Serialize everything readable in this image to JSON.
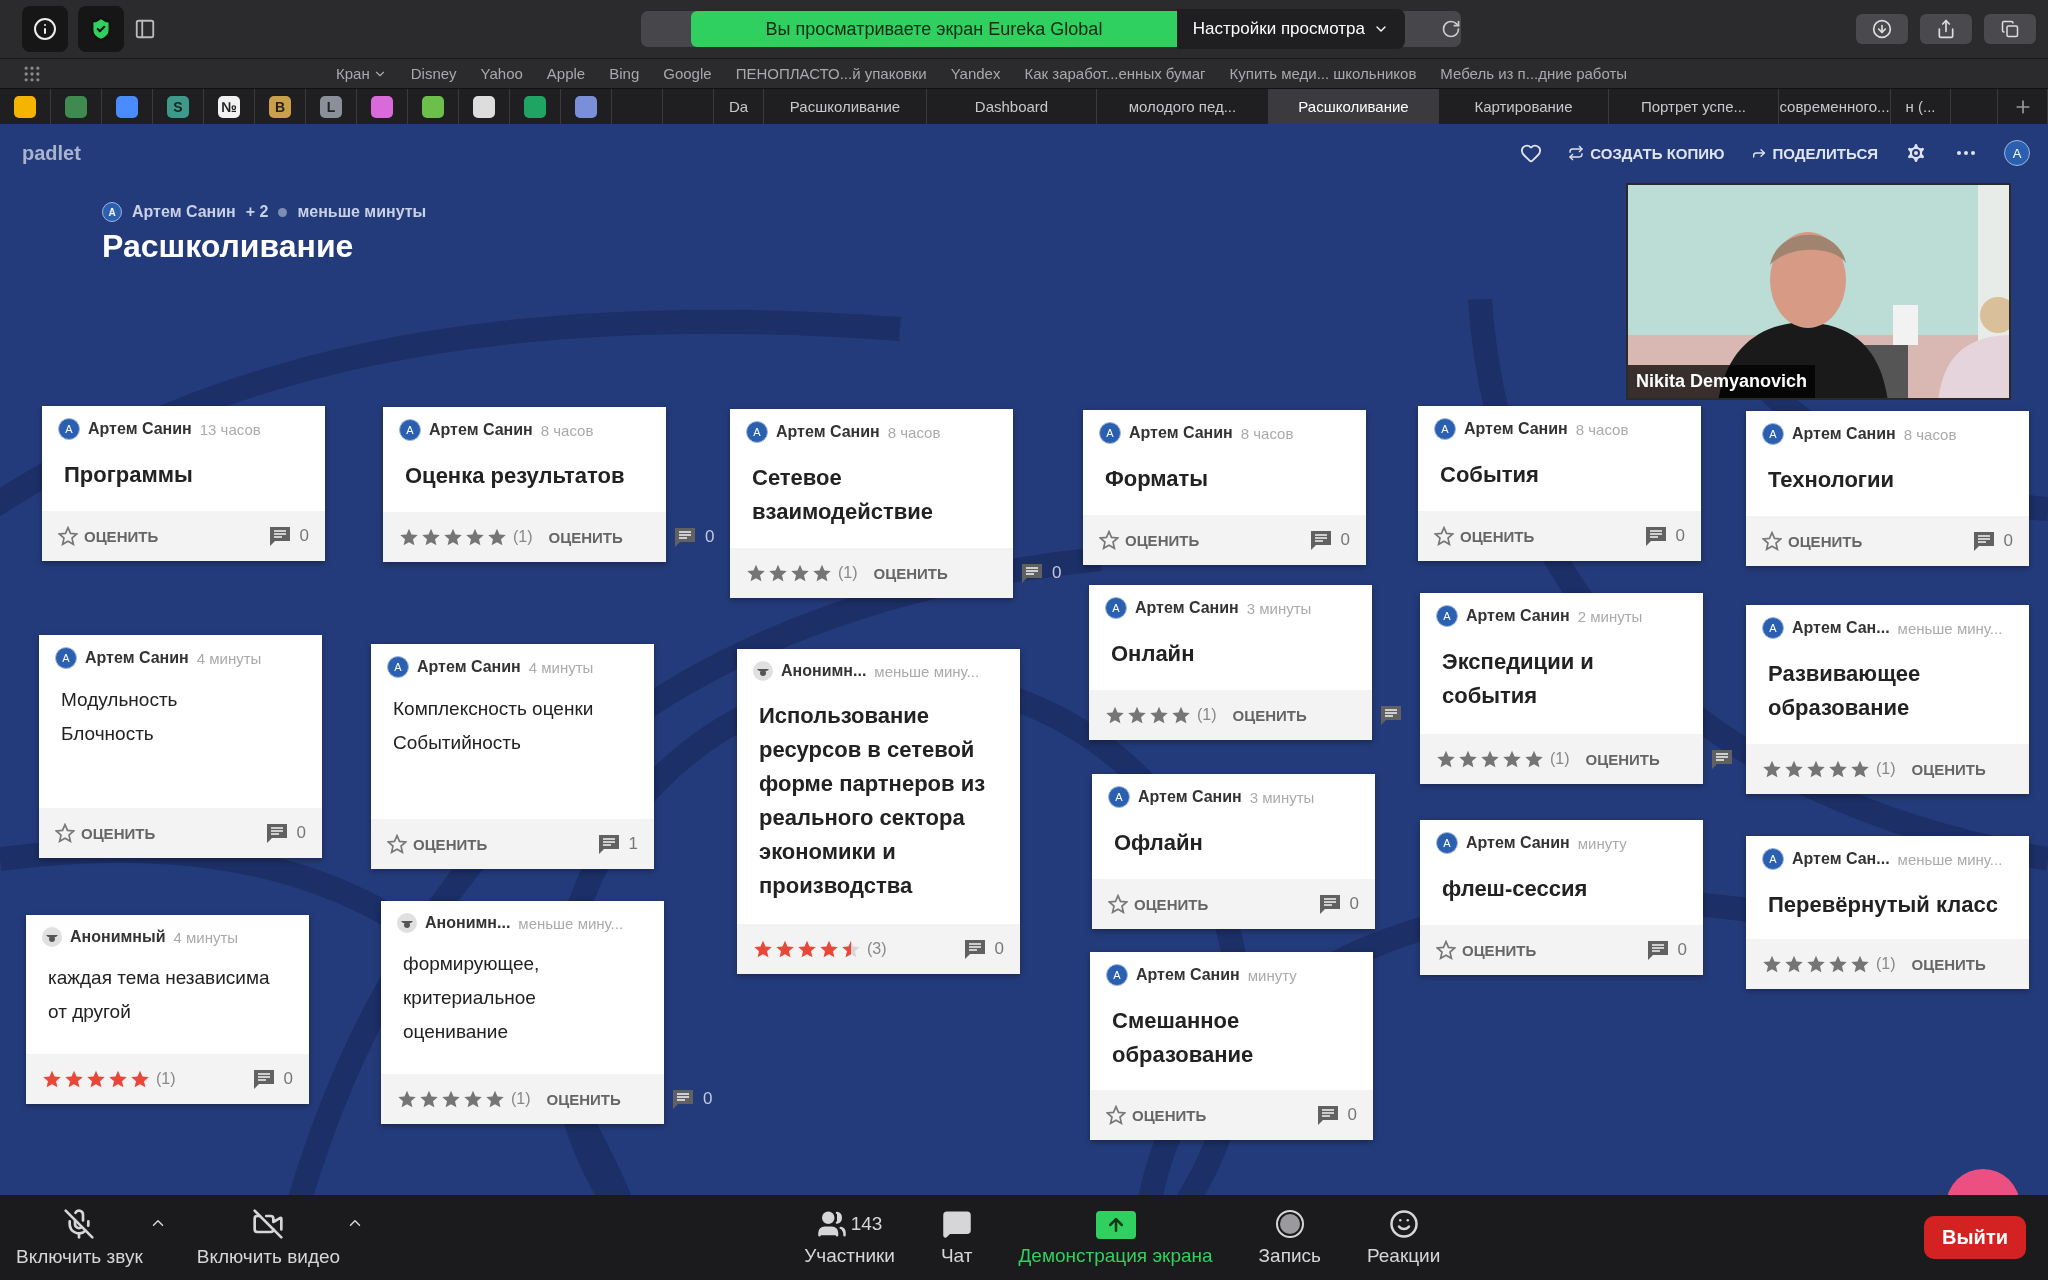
{
  "browser": {
    "viewing_banner": "Вы просматриваете экран Eureka Global",
    "view_options": "Настройки просмотра",
    "bookmarks": [
      {
        "label": "Кран",
        "folder": true
      },
      {
        "label": "Disney",
        "folder": false
      },
      {
        "label": "Yahoo",
        "folder": false
      },
      {
        "label": "Apple",
        "folder": false
      },
      {
        "label": "Bing",
        "folder": false
      },
      {
        "label": "Google",
        "folder": false
      },
      {
        "label": "ПЕНОПЛАСТО...й упаковки",
        "folder": false
      },
      {
        "label": "Yandex",
        "folder": false
      },
      {
        "label": "Как заработ...енных бумаг",
        "folder": false
      },
      {
        "label": "Купить меди... школьников",
        "folder": false
      },
      {
        "label": "Мебель из п...дние работы",
        "folder": false
      }
    ],
    "pinned_tabs": [
      {
        "color": "#f4b400"
      },
      {
        "color": "#3f8a4e"
      },
      {
        "color": "#4a8cff"
      },
      {
        "color": "#3d9a8a",
        "glyph": "S"
      },
      {
        "color": "#f2f2f2",
        "glyph": "№"
      },
      {
        "color": "#caa14a",
        "glyph": "B"
      },
      {
        "color": "#8a8f99",
        "glyph": "L"
      },
      {
        "color": "#d96ad9"
      },
      {
        "color": "#6cbf4a"
      },
      {
        "color": "#dddddd"
      },
      {
        "color": "#1fa463"
      },
      {
        "color": "#7b8fd9"
      }
    ],
    "tabs": [
      {
        "label": "Da",
        "selected": false
      },
      {
        "label": "Расшколивание",
        "selected": false
      },
      {
        "label": "Dashboard",
        "selected": false
      },
      {
        "label": "молодого пед...",
        "selected": false
      },
      {
        "label": "Расшколивание",
        "selected": true
      },
      {
        "label": "Картирование",
        "selected": false
      },
      {
        "label": "Портрет успе...",
        "selected": false
      },
      {
        "label": "современного...",
        "selected": false
      },
      {
        "label": "н (...",
        "selected": false
      }
    ]
  },
  "padlet": {
    "logo": "padlet",
    "copy": "СОЗДАТЬ КОПИЮ",
    "share": "ПОДЕЛИТЬСЯ",
    "user_avatar": "A",
    "board": {
      "avatar": "A",
      "author": "Артем Санин",
      "collaborators": "+ 2",
      "updated": "меньше минуты",
      "title": "Расшколивание"
    },
    "cards": [
      {
        "author": "Артем Санин",
        "avatar": "A",
        "time": "13 часов",
        "kind": "heading",
        "lines": [
          "Программы"
        ],
        "rate_label": "ОЦЕНИТЬ",
        "comment_icon": true,
        "comments": "0"
      },
      {
        "author": "Артем Санин",
        "avatar": "A",
        "time": "8 часов",
        "kind": "heading",
        "lines": [
          "Оценка результатов"
        ],
        "rating": {
          "stars": 5,
          "count": "(1)",
          "mine": false
        },
        "rate_label": "ОЦЕНИТЬ",
        "comment_icon": true,
        "comments": "0"
      },
      {
        "author": "Артем Санин",
        "avatar": "A",
        "time": "8 часов",
        "kind": "heading",
        "lines": [
          "Сетевое взаимодействие"
        ],
        "rating": {
          "stars": 4,
          "count": "(1)",
          "mine": false
        },
        "rate_label": "ОЦЕНИТЬ",
        "comment_icon": true,
        "comments": "0"
      },
      {
        "author": "Артем Санин",
        "avatar": "A",
        "time": "8 часов",
        "kind": "heading",
        "lines": [
          "Форматы"
        ],
        "rate_label": "ОЦЕНИТЬ",
        "comment_icon": true,
        "comments": "0"
      },
      {
        "author": "Артем Санин",
        "avatar": "A",
        "time": "8 часов",
        "kind": "heading",
        "lines": [
          "События"
        ],
        "rate_label": "ОЦЕНИТЬ",
        "comment_icon": true,
        "comments": "0"
      },
      {
        "author": "Артем Санин",
        "avatar": "A",
        "time": "8 часов",
        "kind": "heading",
        "lines": [
          "Технологии"
        ],
        "rate_label": "ОЦЕНИТЬ",
        "comment_icon": true,
        "comments": "0"
      },
      {
        "author": "Артем Санин",
        "avatar": "A",
        "time": "4 минуты",
        "kind": "text",
        "lines": [
          "Модульность",
          "Блочность"
        ],
        "rate_label": "ОЦЕНИТЬ",
        "comment_icon": true,
        "comments": "0"
      },
      {
        "author": "Артем Санин",
        "avatar": "A",
        "time": "4 минуты",
        "kind": "text",
        "lines": [
          "Комплексность оценки",
          "Событийность"
        ],
        "rate_label": "ОЦЕНИТЬ",
        "comment_icon": true,
        "comments": "1"
      },
      {
        "author": "Анонимн...",
        "time": "меньше мину...",
        "kind": "heading",
        "lines": [
          "Использование ресурсов в сетевой форме партнеров из реального сектора экономики и производства"
        ],
        "rating": {
          "stars": 4.5,
          "count": "(3)",
          "mine": true
        },
        "comment_icon": true,
        "comments": "0"
      },
      {
        "author": "Артем Санин",
        "avatar": "A",
        "time": "3 минуты",
        "kind": "heading",
        "lines": [
          "Онлайн"
        ],
        "rating": {
          "stars": 4,
          "count": "(1)",
          "mine": false
        },
        "rate_label": "ОЦЕНИТЬ",
        "comment_icon": true
      },
      {
        "author": "Артем Санин",
        "avatar": "A",
        "time": "2 минуты",
        "kind": "heading",
        "lines": [
          "Экспедиции и события"
        ],
        "rating": {
          "stars": 5,
          "count": "(1)",
          "mine": false
        },
        "rate_label": "ОЦЕНИТЬ",
        "comment_icon": true
      },
      {
        "author": "Артем Сан...",
        "avatar": "A",
        "time": "меньше мину...",
        "kind": "heading",
        "lines": [
          "Развивающее образование"
        ],
        "rating": {
          "stars": 5,
          "count": "(1)",
          "mine": false
        },
        "rate_label": "ОЦЕНИТЬ",
        "comment_icon": false
      },
      {
        "author": "Анонимный",
        "time": "4 минуты",
        "kind": "text",
        "lines": [
          "каждая тема независима от другой"
        ],
        "rating": {
          "stars": 5,
          "count": "(1)",
          "mine": true
        },
        "comment_icon": true,
        "comments": "0"
      },
      {
        "author": "Анонимн...",
        "time": "меньше мину...",
        "kind": "text",
        "lines": [
          "формирующее,",
          "критериальное",
          "оценивание"
        ],
        "rating": {
          "stars": 5,
          "count": "(1)",
          "mine": false
        },
        "rate_label": "ОЦЕНИТЬ",
        "comment_icon": true,
        "comments": "0"
      },
      {
        "author": "Артем Санин",
        "avatar": "A",
        "time": "3 минуты",
        "kind": "heading",
        "lines": [
          "Офлайн"
        ],
        "rate_label": "ОЦЕНИТЬ",
        "comment_icon": true,
        "comments": "0"
      },
      {
        "author": "Артем Санин",
        "avatar": "A",
        "time": "минуту",
        "kind": "heading",
        "lines": [
          "флеш-сессия"
        ],
        "rate_label": "ОЦЕНИТЬ",
        "comment_icon": true,
        "comments": "0"
      },
      {
        "author": "Артем Сан...",
        "avatar": "A",
        "time": "меньше мину...",
        "kind": "heading",
        "lines": [
          "Перевёрнутый класс"
        ],
        "rating": {
          "stars": 5,
          "count": "(1)",
          "mine": false
        },
        "rate_label": "ОЦЕНИТЬ",
        "comment_icon": false
      },
      {
        "author": "Артем Санин",
        "avatar": "A",
        "time": "минуту",
        "kind": "heading",
        "lines": [
          "Смешанное образование"
        ],
        "rate_label": "ОЦЕНИТЬ",
        "comment_icon": true,
        "comments": "0"
      }
    ]
  },
  "video": {
    "name": "Nikita Demyanovich",
    "kind": "picture"
  },
  "meeting_bar": {
    "mute": {
      "label": "Включить звук",
      "muted": true
    },
    "video": {
      "label": "Включить видео",
      "off": true
    },
    "items": [
      {
        "kind": "participants",
        "label": "Участники",
        "count": "143"
      },
      {
        "kind": "chat",
        "label": "Чат"
      },
      {
        "kind": "share",
        "label": "Демонстрация экрана"
      },
      {
        "kind": "record",
        "label": "Запись"
      },
      {
        "kind": "reactions",
        "label": "Реакции"
      }
    ],
    "leave": "Выйти"
  }
}
